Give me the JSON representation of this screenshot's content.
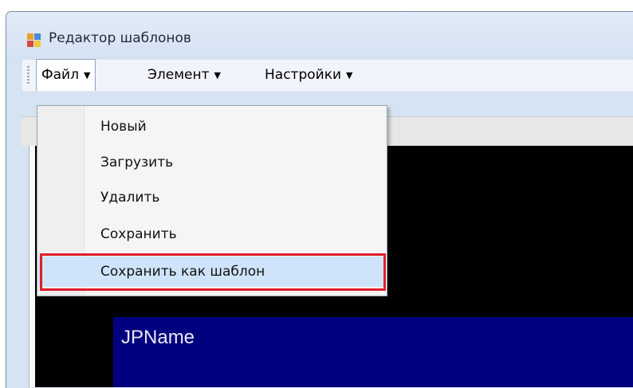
{
  "window": {
    "title": "Редактор шаблонов",
    "icon": "app-window-icon"
  },
  "menubar": {
    "items": [
      {
        "label": "Файл",
        "arrow": "▼"
      },
      {
        "label": "Элемент",
        "arrow": "▼"
      },
      {
        "label": "Настройки",
        "arrow": "▼"
      }
    ]
  },
  "file_menu": {
    "items": [
      {
        "label": "Новый"
      },
      {
        "label": "Загрузить"
      },
      {
        "label": "Удалить"
      },
      {
        "label": "Сохранить"
      },
      {
        "label": "Сохранить как шаблон"
      }
    ],
    "highlighted_color": "#e21d29"
  },
  "canvas": {
    "element_label": "JPName",
    "background": "#000000",
    "element_color": "#00007f"
  }
}
